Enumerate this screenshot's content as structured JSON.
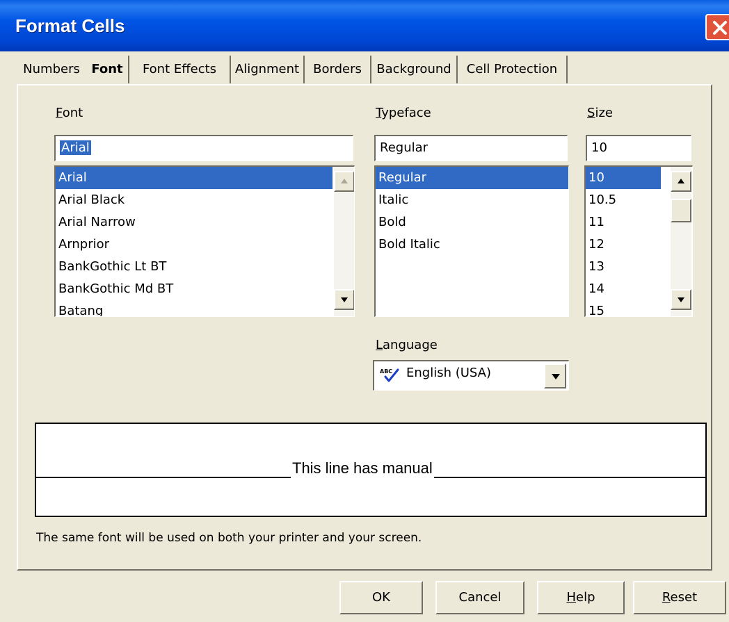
{
  "window": {
    "title": "Format Cells"
  },
  "tabs": [
    {
      "label": "Numbers"
    },
    {
      "label": "Font"
    },
    {
      "label": "Font Effects"
    },
    {
      "label": "Alignment"
    },
    {
      "label": "Borders"
    },
    {
      "label": "Background"
    },
    {
      "label": "Cell Protection"
    }
  ],
  "active_tab": "Font",
  "font": {
    "label_prefix": "",
    "label_accel": "F",
    "label_rest": "ont",
    "input_value": "Arial",
    "items": [
      "Arial",
      "Arial Black",
      "Arial Narrow",
      "Arnprior",
      "BankGothic Lt BT",
      "BankGothic Md BT",
      "Batang"
    ],
    "selected": "Arial"
  },
  "typeface": {
    "label_accel": "T",
    "label_rest": "ypeface",
    "input_value": "Regular",
    "items": [
      "Regular",
      "Italic",
      "Bold",
      "Bold Italic"
    ],
    "selected": "Regular"
  },
  "size": {
    "label_accel": "S",
    "label_rest": "ize",
    "input_value": "10",
    "items": [
      "10",
      "10.5",
      "11",
      "12",
      "13",
      "14",
      "15"
    ],
    "selected": "10"
  },
  "language": {
    "label_accel": "L",
    "label_rest": "anguage",
    "value": "English (USA)",
    "icon": "spellcheck-icon"
  },
  "preview": {
    "text": "This line has manual"
  },
  "info": "The same font will be used on both your printer and your screen.",
  "buttons": {
    "ok": "OK",
    "cancel": "Cancel",
    "help_accel": "H",
    "help_rest": "elp",
    "reset_accel": "R",
    "reset_rest": "eset"
  },
  "colors": {
    "titlebar": "#0054e3",
    "selection": "#316ac5",
    "dialog_bg": "#ece9d8",
    "close": "#e0533a"
  }
}
